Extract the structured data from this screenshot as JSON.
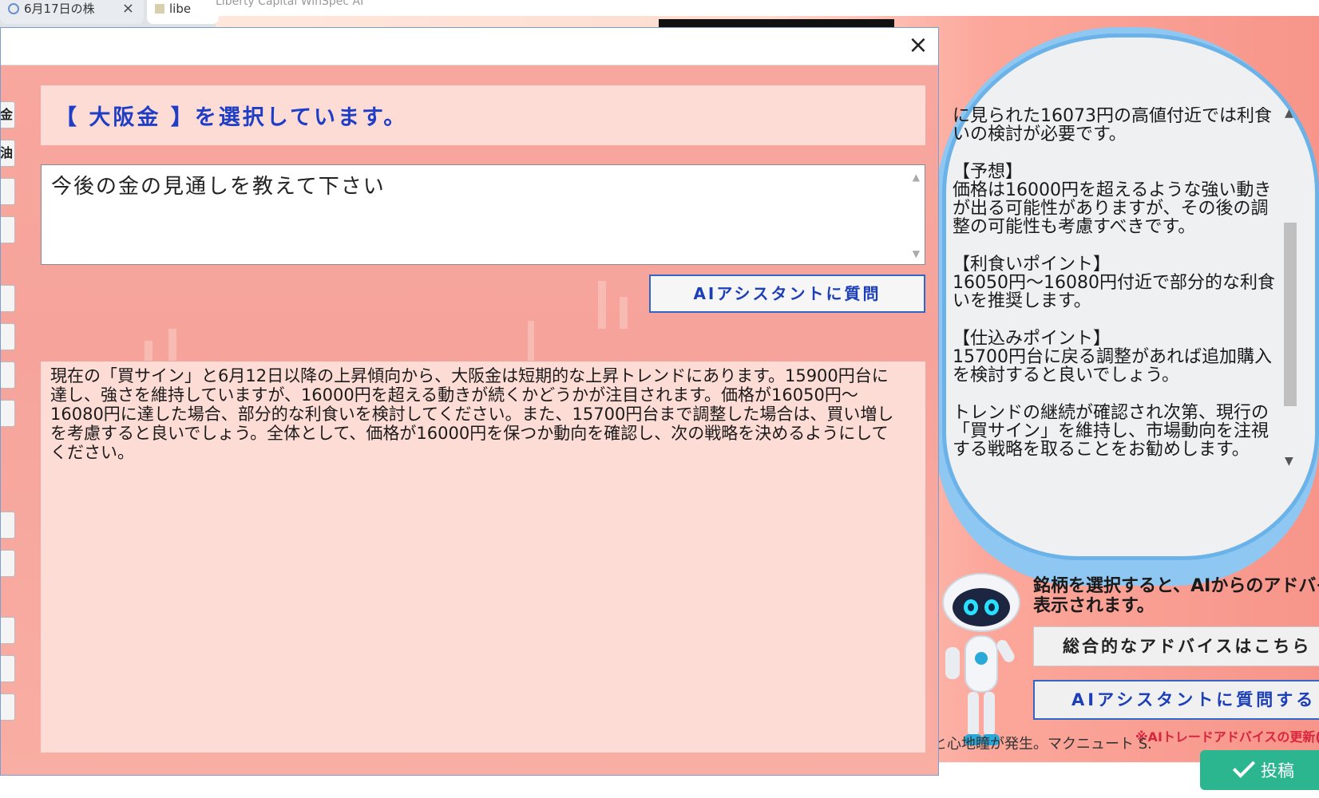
{
  "browser": {
    "tab1_title": "6月17日の株",
    "tab1_close": "×",
    "tab2_title": "libe",
    "address_text": "Liberty Capital WinSpec AI"
  },
  "dialog": {
    "close_label": "×",
    "left_button_labels": [
      "金",
      "油"
    ],
    "selection_text": "【 大阪金 】を選択しています。",
    "question_value": "今後の金の見通しを教えて下さい",
    "ask_button_label": "AIアシスタントに質問",
    "answer_text": "現在の「買サイン」と6月12日以降の上昇傾向から、大阪金は短期的な上昇トレンドにあります。15900円台に達し、強さを維持していますが、16000円を超える動きが続くかどうかが注目されます。価格が16050円～16080円に達した場合、部分的な利食いを検討してください。また、15700円台まで調整した場合は、買い増しを考慮すると良いでしょう。全体として、価格が16000円を保つか動向を確認し、次の戦略を決めるようにしてください。"
  },
  "advice_panel": {
    "paragraphs": [
      "に見られた16073円の高値付近では利食いの検討が必要です。",
      "【予想】\n価格は16000円を超えるような強い動きが出る可能性がありますが、その後の調整の可能性も考慮すべきです。",
      "【利食いポイント】\n16050円～16080円付近で部分的な利食いを推奨します。",
      "【仕込みポイント】\n15700円台に戻る調整があれば追加購入を検討すると良いでしょう。",
      "トレンドの継続が確認され次第、現行の「買サイン」を維持し、市場動向を注視する戦略を取ることをお勧めします。"
    ],
    "hint_text_line1": "銘柄を選択すると、AIからのアドバイ",
    "hint_text_line2": "表示されます。",
    "overall_button_label": "総合的なアドバイスはこちら",
    "ask_button_label": "AIアシスタントに質問する",
    "note_text": "※AIトレードアドバイスの更新("
  },
  "page": {
    "post_button_label": "投稿",
    "bottom_text": "線と心地瞳が発生。マクニュート S."
  },
  "colors": {
    "dialog_bg": "#fab0a6",
    "accent_blue": "#1f3ec6",
    "post_green": "#2bb68f",
    "note_red": "#d7263d"
  }
}
